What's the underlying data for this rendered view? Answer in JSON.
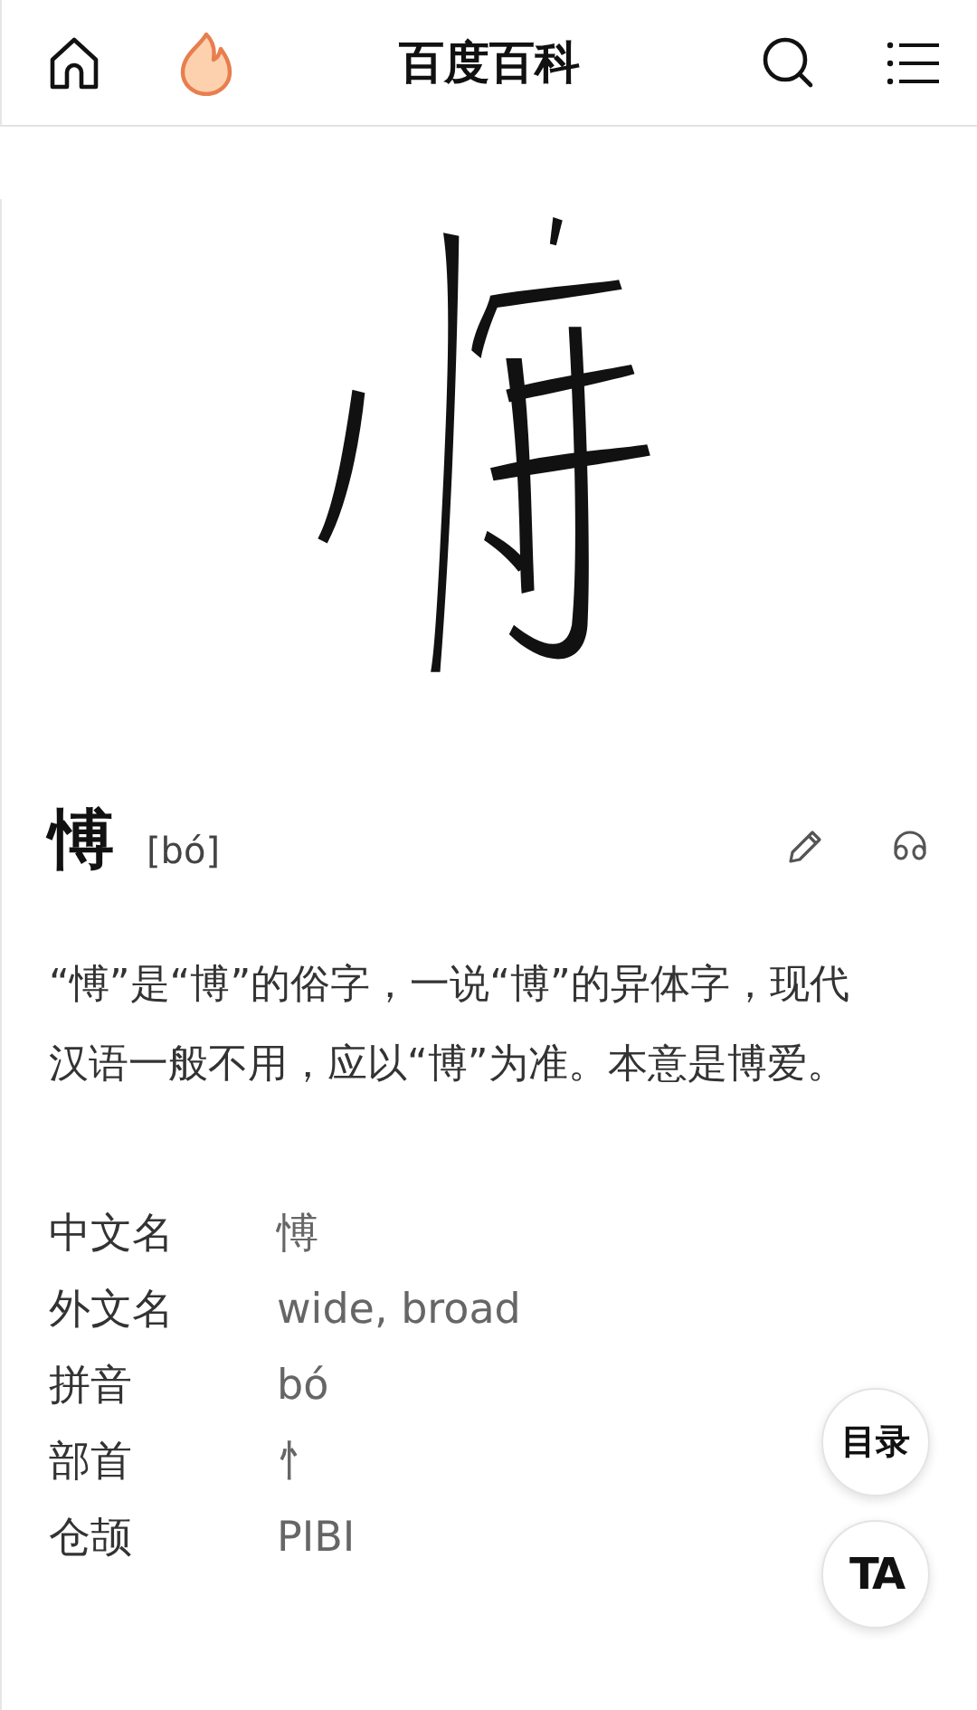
{
  "header": {
    "title": "百度百科"
  },
  "entry": {
    "character": "愽",
    "pinyin": "[bó]",
    "summary": "“愽”是“博”的俗字，一说“博”的异体字，现代汉语一般不用，应以“博”为准。本意是博爱。",
    "info": [
      {
        "label": "中文名",
        "value": "愽"
      },
      {
        "label": "外文名",
        "value": "wide, broad"
      },
      {
        "label": "拼音",
        "value": "bó"
      },
      {
        "label": "部首",
        "value": "忄"
      },
      {
        "label": "仓颉",
        "value": "PIBI"
      }
    ]
  },
  "float_buttons": [
    {
      "label": "目录"
    },
    {
      "label": "TA"
    }
  ]
}
